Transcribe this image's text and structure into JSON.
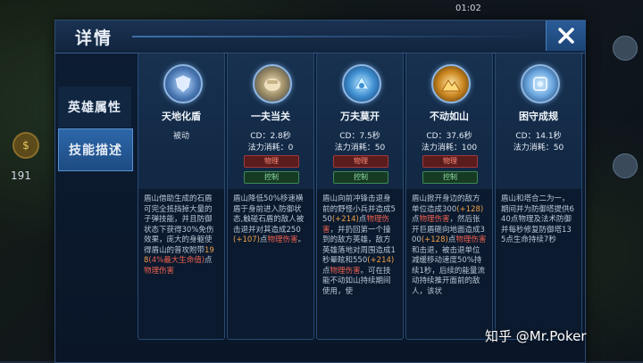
{
  "background": {
    "gold_count": "191",
    "status_time": "01:02"
  },
  "dialog": {
    "title": "详情",
    "tabs": [
      {
        "label": "英雄属性",
        "active": false
      },
      {
        "label": "技能描述",
        "active": true
      }
    ]
  },
  "skills": [
    {
      "name": "天地化盾",
      "passive_label": "被动",
      "icon": "shield-skill-icon",
      "desc_parts": [
        {
          "t": "盾山借助生成的石盾可完全抵挡掉大量的子弹技能，并且防御状态下获得30%免伤效果，庞大的身躯使得盾山的普攻附带",
          "c": ""
        },
        {
          "t": "198",
          "c": "orange"
        },
        {
          "t": "(4%最大生命值)",
          "c": "red"
        },
        {
          "t": "点",
          "c": ""
        },
        {
          "t": "物理伤害",
          "c": "red"
        }
      ]
    },
    {
      "name": "一夫当关",
      "cd": "CD：2.8秒",
      "mana": "法力消耗：0",
      "tag_red": "物理",
      "tag_green": "控制",
      "icon": "fist-skill-icon",
      "desc_parts": [
        {
          "t": "盾山降低50%移速横盾于身前进入防御状态,触碰石盾的敌人被击退并对其造成250",
          "c": ""
        },
        {
          "t": "(+107)",
          "c": "orange"
        },
        {
          "t": "点",
          "c": ""
        },
        {
          "t": "物理伤害",
          "c": "red"
        },
        {
          "t": "。",
          "c": ""
        }
      ]
    },
    {
      "name": "万夫莫开",
      "cd": "CD：7.5秒",
      "mana": "法力消耗：50",
      "tag_red": "物理",
      "tag_green": "控制",
      "icon": "charge-skill-icon",
      "desc_parts": [
        {
          "t": "盾山向前冲锋击退身前的野怪小兵并造成550",
          "c": ""
        },
        {
          "t": "(+214)",
          "c": "orange"
        },
        {
          "t": "点",
          "c": ""
        },
        {
          "t": "物理伤害",
          "c": "red"
        },
        {
          "t": "，并扔回第一个撞到的敌方英雄，敌方英雄落地对周围造成1秒晕眩和550",
          "c": ""
        },
        {
          "t": "(+214)",
          "c": "orange"
        },
        {
          "t": "点",
          "c": ""
        },
        {
          "t": "物理伤害",
          "c": "red"
        },
        {
          "t": "。可在技能不动如山持续期间使用，使",
          "c": ""
        }
      ]
    },
    {
      "name": "不动如山",
      "cd": "CD：37.6秒",
      "mana": "法力消耗：100",
      "tag_red": "物理",
      "tag_green": "控制",
      "icon": "mountain-skill-icon",
      "desc_parts": [
        {
          "t": "盾山掀开身边的敌方单位造成300",
          "c": ""
        },
        {
          "t": "(+128)",
          "c": "orange"
        },
        {
          "t": "点",
          "c": ""
        },
        {
          "t": "物理伤害",
          "c": "red"
        },
        {
          "t": "，然后张开巨盾砸向地面造成300",
          "c": ""
        },
        {
          "t": "(+128)",
          "c": "orange"
        },
        {
          "t": "点",
          "c": ""
        },
        {
          "t": "物理伤害",
          "c": "red"
        },
        {
          "t": "和击退，被击退单位减缓移动速度50%持续1秒，后续的能量流动持续推开面前的敌人，该状",
          "c": ""
        }
      ]
    },
    {
      "name": "困守成规",
      "cd": "CD：14.1秒",
      "mana": "法力消耗：50",
      "icon": "guard-skill-icon",
      "desc_parts": [
        {
          "t": "盾山和塔合二为一，期间并为防御塔提供640点物理及法术防御并每秒修复防御塔135点生命持续7秒",
          "c": ""
        }
      ]
    }
  ],
  "watermark": "知乎 @Mr.Poker",
  "colors": {
    "highlight_orange": "#f0a04a",
    "highlight_red": "#f06050",
    "tab_active": "#2d67a9"
  }
}
